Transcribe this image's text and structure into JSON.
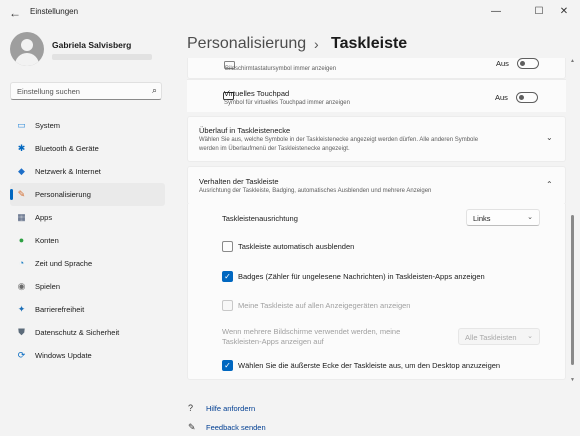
{
  "window": {
    "back_icon": "←",
    "title": "Einstellungen",
    "minimize": "—",
    "maximize": "☐",
    "close": "✕"
  },
  "profile": {
    "name": "Gabriela Salvisberg"
  },
  "search": {
    "placeholder": "Einstellung suchen",
    "icon": "⌕"
  },
  "sidebar": {
    "items": [
      {
        "label": "System",
        "icon": "▭",
        "color": "#2b88d8"
      },
      {
        "label": "Bluetooth & Geräte",
        "icon": "✱",
        "color": "#0067c0"
      },
      {
        "label": "Netzwerk & Internet",
        "icon": "◆",
        "color": "#1e6fc8"
      },
      {
        "label": "Personalisierung",
        "icon": "✎",
        "color": "#d46a2b"
      },
      {
        "label": "Apps",
        "icon": "▦",
        "color": "#4a5a78"
      },
      {
        "label": "Konten",
        "icon": "●",
        "color": "#2ea043"
      },
      {
        "label": "Zeit und Sprache",
        "icon": "◔",
        "color": "#1c7fc4"
      },
      {
        "label": "Spielen",
        "icon": "◉",
        "color": "#6b6b6b"
      },
      {
        "label": "Barrierefreiheit",
        "icon": "✦",
        "color": "#1c6fb8"
      },
      {
        "label": "Datenschutz & Sicherheit",
        "icon": "⛊",
        "color": "#5c6b7a"
      },
      {
        "label": "Windows Update",
        "icon": "⟳",
        "color": "#0067c0"
      }
    ],
    "active_index": 3
  },
  "header": {
    "crumb_parent": "Personalisierung",
    "separator": "›",
    "crumb_current": "Taskleiste"
  },
  "content": {
    "row_keyboard": {
      "subtitle": "Bildschirmtastatursymbol immer anzeigen",
      "state": "Aus"
    },
    "row_touchpad": {
      "title": "Virtuelles Touchpad",
      "subtitle": "Symbol für virtuelles Touchpad immer anzeigen",
      "state": "Aus"
    },
    "overflow": {
      "title": "Überlauf in Taskleistenecke",
      "subtitle_line1": "Wählen Sie aus, welche Symbole in der Taskleistenecke angezeigt werden dürfen. Alle anderen Symbole",
      "subtitle_line2": "werden im Überlaufmenü der Taskleistenecke angezeigt.",
      "chevron": "⌄"
    },
    "behavior": {
      "title": "Verhalten der Taskleiste",
      "subtitle": "Ausrichtung der Taskleiste, Badging, automatisches Ausblenden und mehrere Anzeigen",
      "chevron": "⌃",
      "alignment_label": "Taskleistenausrichtung",
      "alignment_value": "Links",
      "autohide_label": "Taskleiste automatisch ausblenden",
      "autohide_checked": false,
      "badges_label": "Badges (Zähler für ungelesene Nachrichten) in Taskleisten-Apps anzeigen",
      "badges_checked": true,
      "all_displays_label": "Meine Taskleiste auf allen Anzeigegeräten anzeigen",
      "all_displays_checked": false,
      "multi_label_line1": "Wenn mehrere Bildschirme verwendet werden, meine",
      "multi_label_line2": "Taskleisten-Apps anzeigen auf",
      "multi_value": "Alle Taskleisten",
      "corner_label": "Wählen Sie die äußerste Ecke der Taskleiste aus, um den Desktop anzuzeigen",
      "corner_checked": true,
      "check_glyph": "✓",
      "dropdown_chevron": "⌄"
    }
  },
  "footer": {
    "help_label": "Hilfe anfordern",
    "feedback_label": "Feedback senden"
  },
  "colors": {
    "accent": "#0067c0",
    "background": "#f3f3f3",
    "card": "#fbfbfb"
  }
}
